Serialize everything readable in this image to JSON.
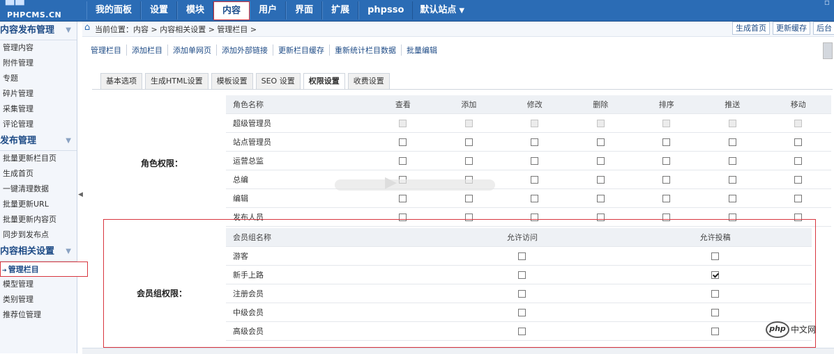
{
  "logo": {
    "brand": "PHPCMS.CN"
  },
  "nav": {
    "items": [
      "我的面板",
      "设置",
      "模块",
      "内容",
      "用户",
      "界面",
      "扩展",
      "phpsso"
    ],
    "active_index": 3,
    "site_label": "默认站点"
  },
  "sidebar": {
    "sections": [
      {
        "title": "内容发布管理",
        "items": [
          "管理内容",
          "附件管理",
          "专题",
          "碎片管理",
          "采集管理",
          "评论管理"
        ]
      },
      {
        "title": "发布管理",
        "items": [
          "批量更新栏目页",
          "生成首页",
          "一键清理数据",
          "批量更新URL",
          "批量更新内容页",
          "同步到发布点"
        ]
      },
      {
        "title": "内容相关设置",
        "items": [
          "管理栏目",
          "模型管理",
          "类别管理",
          "推荐位管理"
        ]
      }
    ]
  },
  "breadcrumb": {
    "text": "当前位置：内容 > 内容相关设置 > 管理栏目 >"
  },
  "header_buttons": [
    "生成首页",
    "更新缓存",
    "后台"
  ],
  "subnav": [
    "管理栏目",
    "添加栏目",
    "添加单网页",
    "添加外部链接",
    "更新栏目缓存",
    "重新统计栏目数据",
    "批量编辑"
  ],
  "tabs": {
    "items": [
      "基本选项",
      "生成HTML设置",
      "模板设置",
      "SEO 设置",
      "权限设置",
      "收费设置"
    ],
    "active_index": 4
  },
  "role_perm": {
    "label": "角色权限：",
    "columns": [
      "角色名称",
      "查看",
      "添加",
      "修改",
      "删除",
      "排序",
      "推送",
      "移动"
    ],
    "rows": [
      {
        "name": "超级管理员",
        "checks": [
          false,
          false,
          false,
          false,
          false,
          false,
          false
        ],
        "disabled": true
      },
      {
        "name": "站点管理员",
        "checks": [
          false,
          false,
          false,
          false,
          false,
          false,
          false
        ],
        "disabled": false
      },
      {
        "name": "运营总监",
        "checks": [
          false,
          false,
          false,
          false,
          false,
          false,
          false
        ],
        "disabled": false
      },
      {
        "name": "总编",
        "checks": [
          false,
          false,
          false,
          false,
          false,
          false,
          false
        ],
        "disabled": false
      },
      {
        "name": "编辑",
        "checks": [
          false,
          false,
          false,
          false,
          false,
          false,
          false
        ],
        "disabled": false
      },
      {
        "name": "发布人员",
        "checks": [
          false,
          false,
          false,
          false,
          false,
          false,
          false
        ],
        "disabled": false
      }
    ]
  },
  "member_perm": {
    "label": "会员组权限：",
    "columns": [
      "会员组名称",
      "允许访问",
      "允许投稿"
    ],
    "rows": [
      {
        "name": "游客",
        "checks": [
          false,
          false
        ]
      },
      {
        "name": "新手上路",
        "checks": [
          false,
          true
        ]
      },
      {
        "name": "注册会员",
        "checks": [
          false,
          false
        ]
      },
      {
        "name": "中级会员",
        "checks": [
          false,
          false
        ]
      },
      {
        "name": "高级会员",
        "checks": [
          false,
          false
        ]
      }
    ]
  },
  "watermark": {
    "badge": "php",
    "text": "中文网"
  }
}
